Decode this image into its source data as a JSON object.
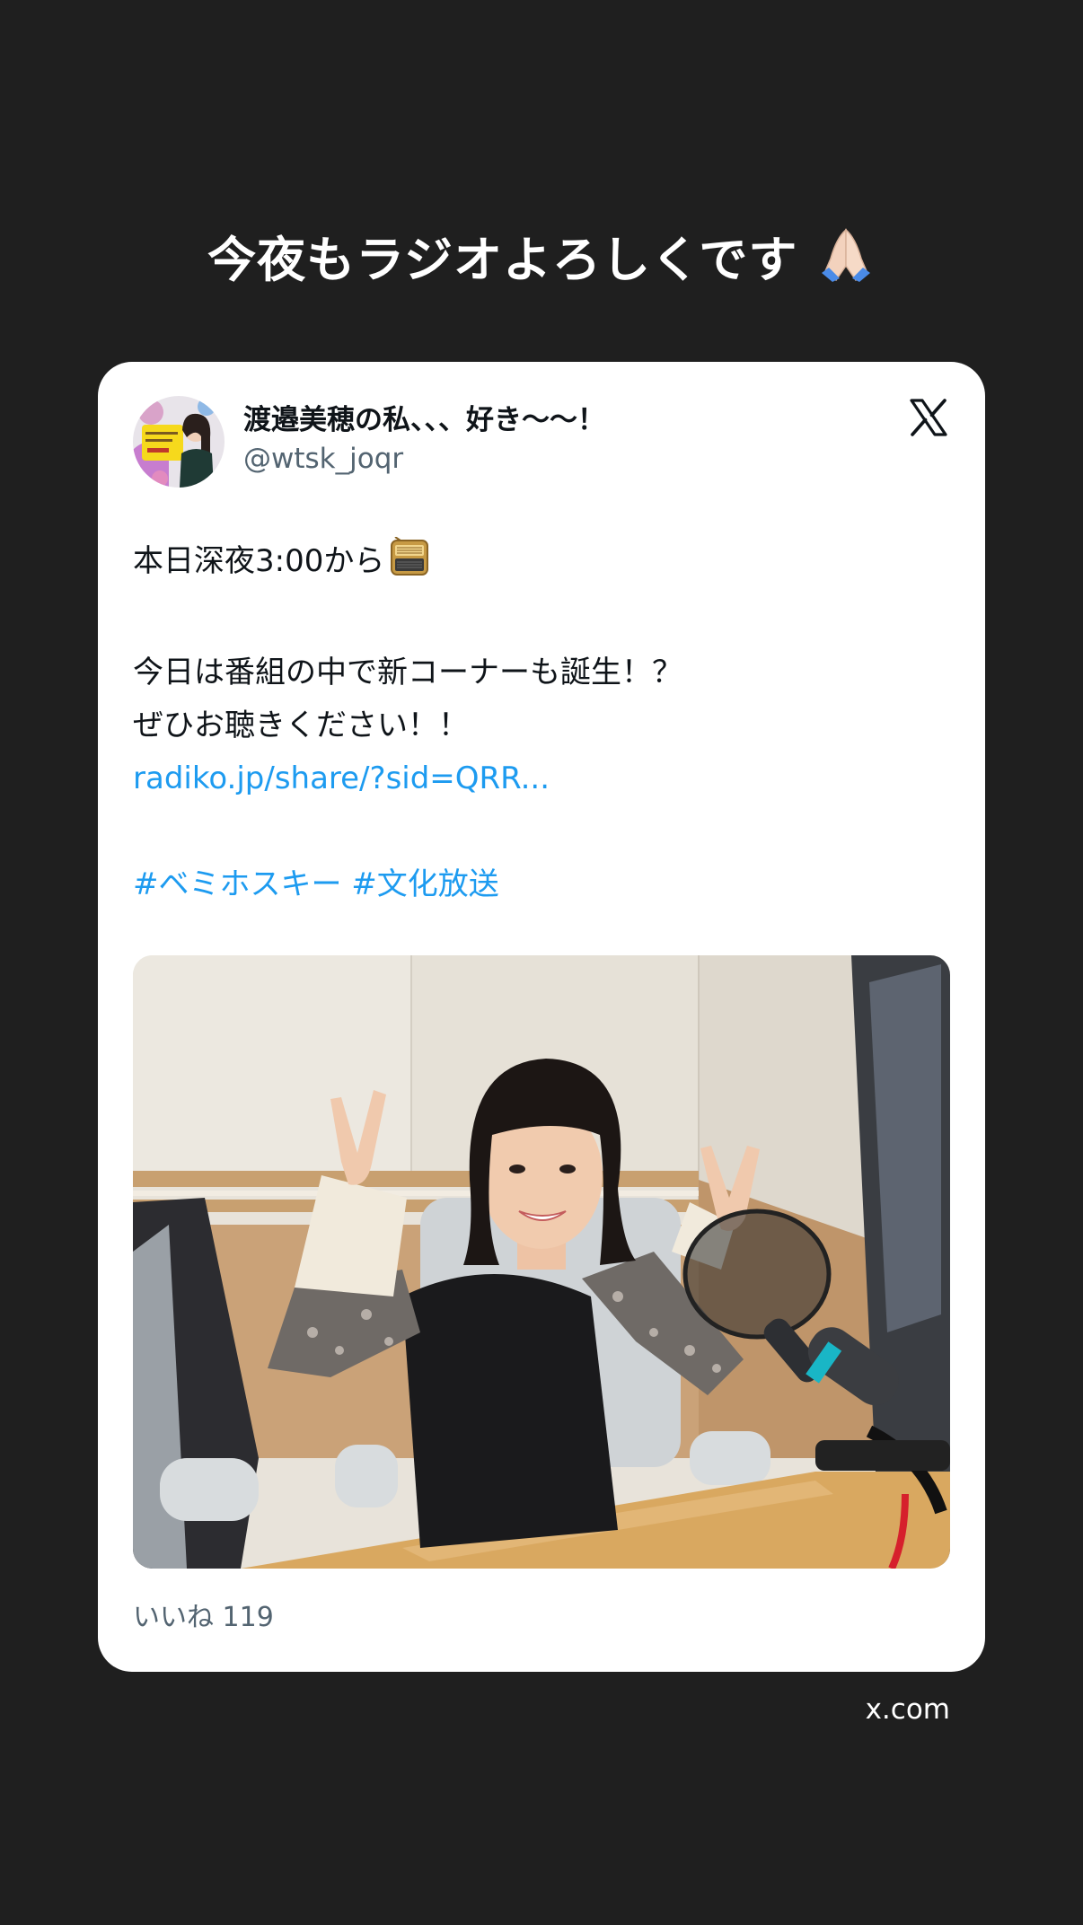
{
  "story": {
    "caption": "今夜もラジオよろしくです",
    "caption_emoji_name": "folded-hands-icon",
    "source_label": "x.com"
  },
  "tweet": {
    "display_name": "渡邉美穂の私、、、好き〜〜！",
    "handle": "@wtsk_joqr",
    "platform_icon": "x-logo-icon",
    "lines": {
      "l1": "本日深夜3:00から",
      "l3": "今日は番組の中で新コーナーも誕生！？",
      "l4": "ぜひお聴きください！！",
      "link": "radiko.jp/share/?sid=QRR...",
      "hashtags": "#ベミホスキー #文化放送"
    },
    "emoji_after_l1": "radio-icon",
    "likes_label": "いいね 119"
  },
  "colors": {
    "background": "#1f1f1f",
    "card": "#ffffff",
    "link": "#1d9bf0",
    "text": "#0f1419",
    "muted": "#536471"
  }
}
